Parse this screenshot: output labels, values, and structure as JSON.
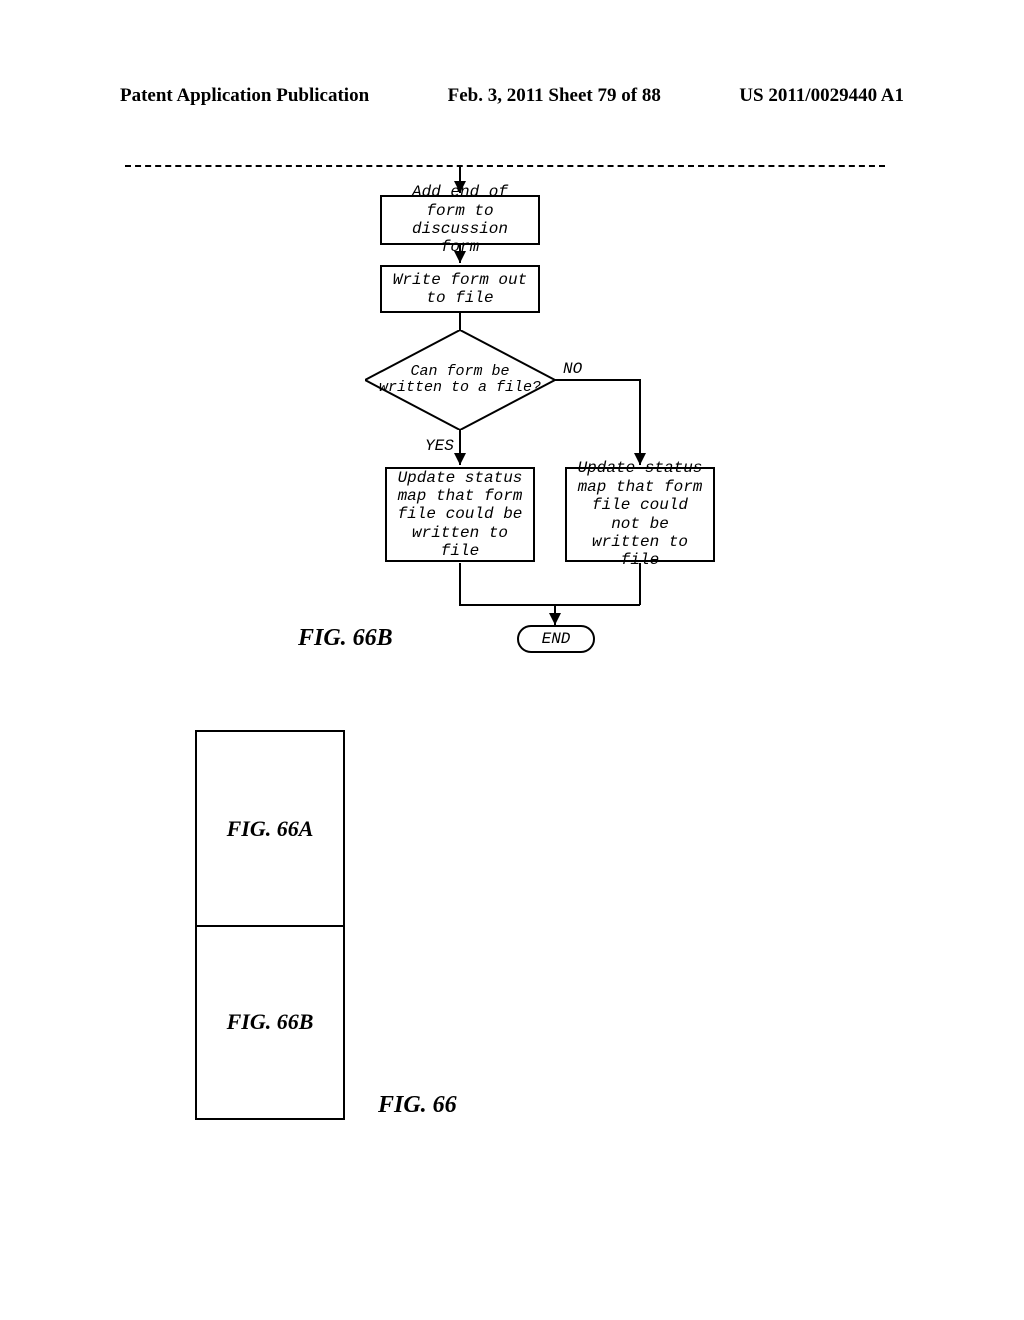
{
  "header": {
    "left": "Patent Application Publication",
    "center": "Feb. 3, 2011  Sheet 79 of 88",
    "right": "US 2011/0029440 A1"
  },
  "flow": {
    "box1": "Add end of form to discussion form",
    "box2": "Write form out to file",
    "decision": "Can form be written to a file?",
    "yes": "YES",
    "no": "NO",
    "box_yes": "Update status map that form file could be written to file",
    "box_no": "Update status map that form file could not be written to file",
    "end": "END"
  },
  "figs": {
    "caption_main": "FIG. 66B",
    "composite_top": "FIG. 66A",
    "composite_bot": "FIG. 66B",
    "composite_caption": "FIG. 66"
  }
}
